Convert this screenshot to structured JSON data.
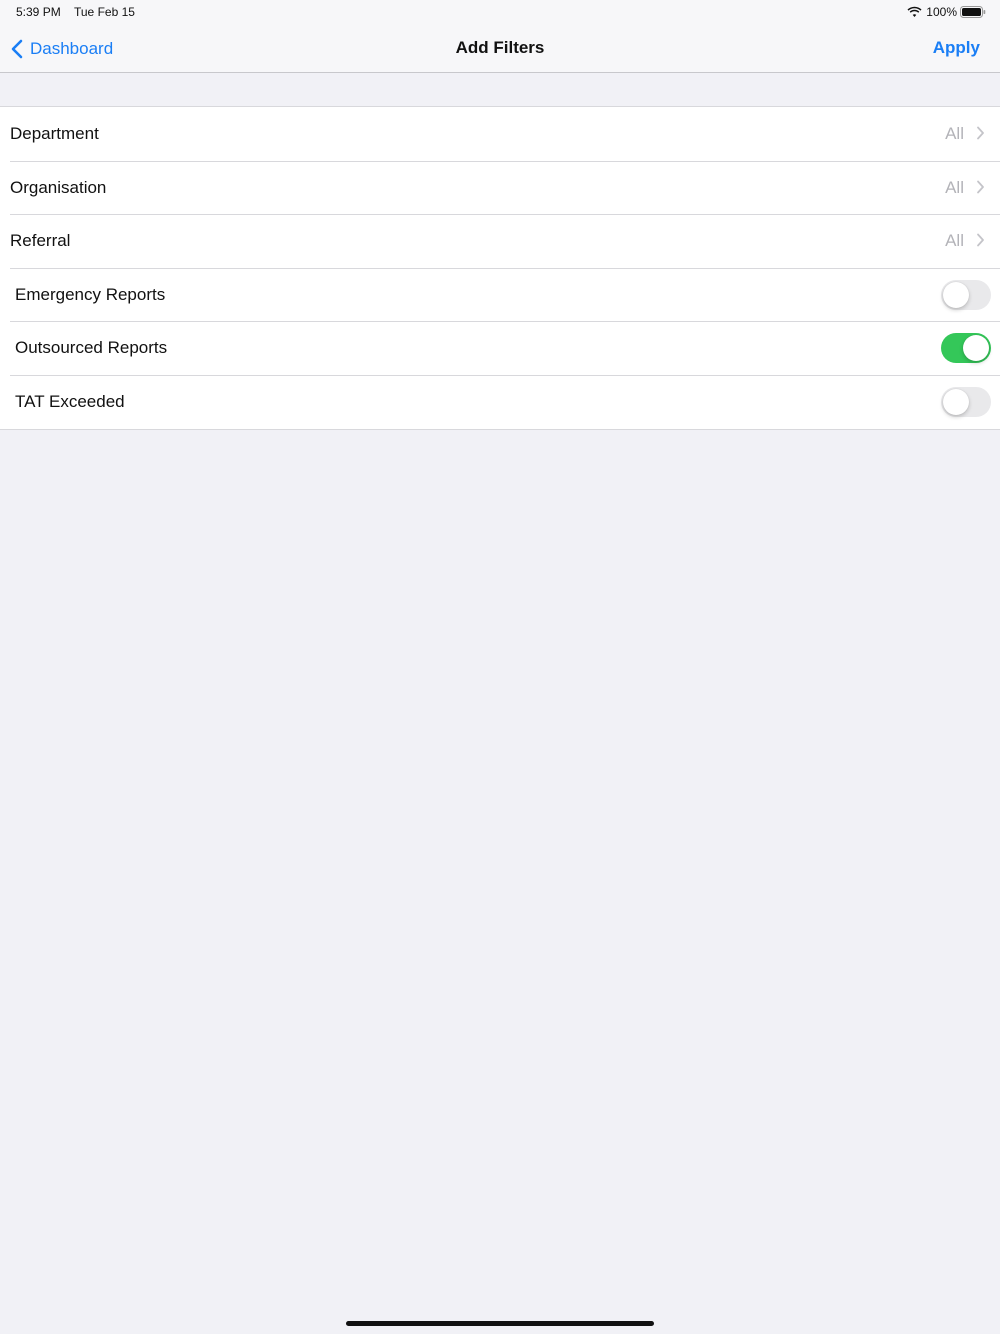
{
  "status_bar": {
    "time": "5:39 PM",
    "date": "Tue Feb 15",
    "battery_percent": "100%",
    "wifi_icon": "wifi-icon",
    "battery_icon": "battery-icon"
  },
  "nav": {
    "back_label": "Dashboard",
    "back_icon": "chevron-left-icon",
    "title": "Add Filters",
    "apply_label": "Apply"
  },
  "colors": {
    "accent": "#1a7ef5",
    "switch_on": "#34c759",
    "background": "#f1f1f6"
  },
  "filters": [
    {
      "label": "Department",
      "value": "All",
      "type": "disclosure"
    },
    {
      "label": "Organisation",
      "value": "All",
      "type": "disclosure"
    },
    {
      "label": "Referral",
      "value": "All",
      "type": "disclosure"
    },
    {
      "label": "Emergency Reports",
      "type": "toggle",
      "on": false
    },
    {
      "label": "Outsourced Reports",
      "type": "toggle",
      "on": true
    },
    {
      "label": "TAT Exceeded",
      "type": "toggle",
      "on": false
    }
  ]
}
